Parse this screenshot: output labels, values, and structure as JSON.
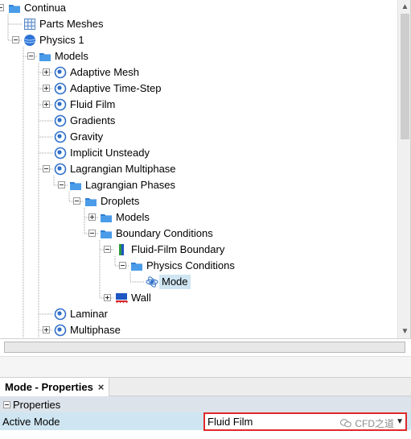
{
  "tree": {
    "nodes": [
      {
        "label": "Continua",
        "level": 0,
        "icon": "folder-icon",
        "expander": "minus",
        "row": 0
      },
      {
        "label": "Parts Meshes",
        "level": 1,
        "icon": "mesh-grid-icon",
        "expander": "none",
        "row": 1
      },
      {
        "label": "Physics 1",
        "level": 1,
        "icon": "physics-sphere-icon",
        "expander": "minus",
        "row": 2
      },
      {
        "label": "Models",
        "level": 2,
        "icon": "folder-icon",
        "expander": "minus",
        "row": 3
      },
      {
        "label": "Adaptive Mesh",
        "level": 3,
        "icon": "model-icon",
        "expander": "plus",
        "row": 4
      },
      {
        "label": "Adaptive Time-Step",
        "level": 3,
        "icon": "model-icon",
        "expander": "plus",
        "row": 5
      },
      {
        "label": "Fluid Film",
        "level": 3,
        "icon": "model-icon",
        "expander": "plus",
        "row": 6
      },
      {
        "label": "Gradients",
        "level": 3,
        "icon": "model-icon",
        "expander": "none",
        "row": 7
      },
      {
        "label": "Gravity",
        "level": 3,
        "icon": "model-icon",
        "expander": "none",
        "row": 8
      },
      {
        "label": "Implicit Unsteady",
        "level": 3,
        "icon": "model-icon",
        "expander": "none",
        "row": 9
      },
      {
        "label": "Lagrangian Multiphase",
        "level": 3,
        "icon": "model-icon",
        "expander": "minus",
        "row": 10
      },
      {
        "label": "Lagrangian Phases",
        "level": 4,
        "icon": "folder-icon",
        "expander": "minus",
        "row": 11
      },
      {
        "label": "Droplets",
        "level": 5,
        "icon": "folder-icon",
        "expander": "minus",
        "row": 12
      },
      {
        "label": "Models",
        "level": 6,
        "icon": "folder-icon",
        "expander": "plus",
        "row": 13
      },
      {
        "label": "Boundary Conditions",
        "level": 6,
        "icon": "folder-icon",
        "expander": "minus",
        "row": 14
      },
      {
        "label": "Fluid-Film Boundary",
        "level": 7,
        "icon": "boundary-icon",
        "expander": "minus",
        "row": 15
      },
      {
        "label": "Physics Conditions",
        "level": 8,
        "icon": "folder-icon",
        "expander": "minus",
        "row": 16
      },
      {
        "label": "Mode",
        "level": 9,
        "icon": "condition-icon",
        "expander": "none",
        "row": 17,
        "selected": true
      },
      {
        "label": "Wall",
        "level": 7,
        "icon": "wall-icon",
        "expander": "plus",
        "row": 18
      },
      {
        "label": "Laminar",
        "level": 3,
        "icon": "model-icon",
        "expander": "none",
        "row": 19
      },
      {
        "label": "Multiphase",
        "level": 3,
        "icon": "model-icon",
        "expander": "plus",
        "row": 20
      }
    ]
  },
  "properties": {
    "tab_title": "Mode - Properties",
    "close_glyph": "×",
    "group_label": "Properties",
    "row_name": "Active Mode",
    "row_value": "Fluid Film",
    "watermark": "CFD之道"
  },
  "colors": {
    "selection": "#cfe6f2",
    "folder": "#2f7fd6",
    "highlight_border": "#e0292b"
  }
}
